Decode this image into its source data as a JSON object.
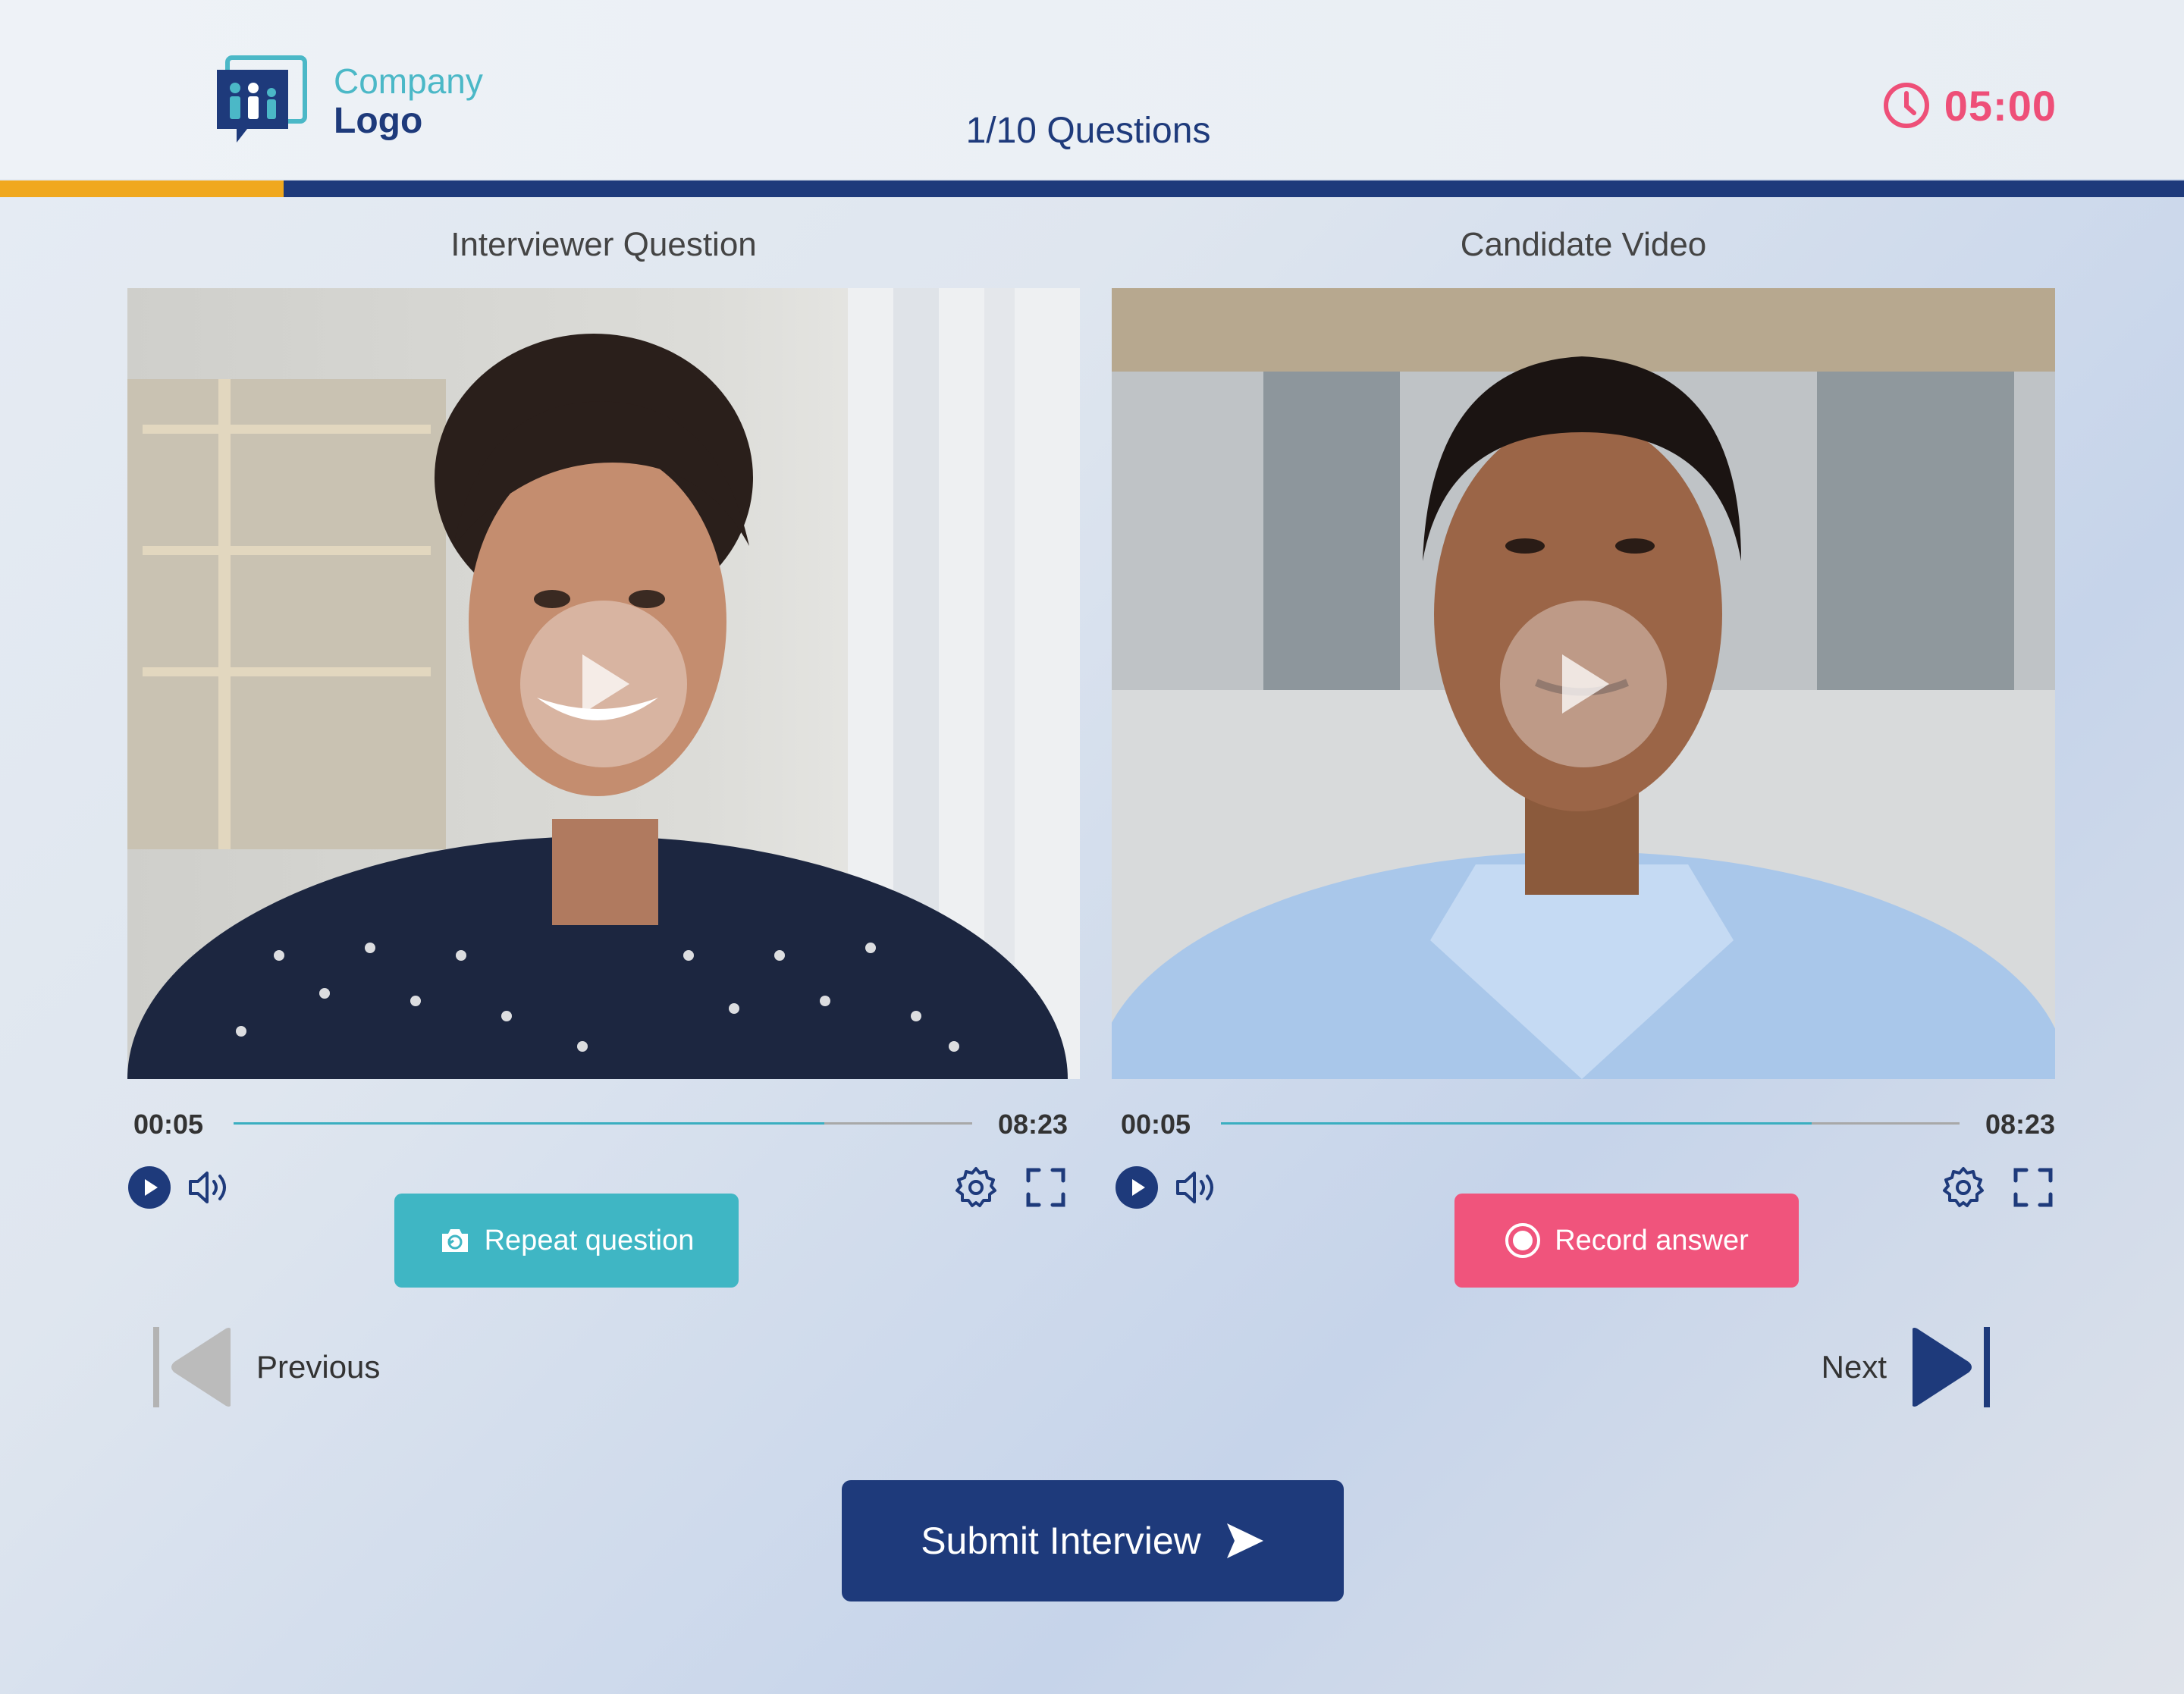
{
  "header": {
    "logo_line1": "Company",
    "logo_line2": "Logo",
    "question_counter": "1/10 Questions",
    "timer": "05:00",
    "progress_fraction": 0.13
  },
  "colors": {
    "brand_navy": "#1e3a7b",
    "accent_teal": "#3fb6c4",
    "accent_pink": "#f0547c",
    "progress_orange": "#f0a81e"
  },
  "interviewer": {
    "title": "Interviewer Question",
    "current_time": "00:05",
    "duration": "08:23",
    "played_fraction": 0.8,
    "action_label": "Repeat question",
    "action_icon": "camera-rotate-icon"
  },
  "candidate": {
    "title": "Candidate Video",
    "current_time": "00:05",
    "duration": "08:23",
    "played_fraction": 0.8,
    "action_label": "Record answer",
    "action_icon": "record-icon"
  },
  "navigation": {
    "previous_label": "Previous",
    "next_label": "Next"
  },
  "submit": {
    "label": "Submit Interview"
  }
}
